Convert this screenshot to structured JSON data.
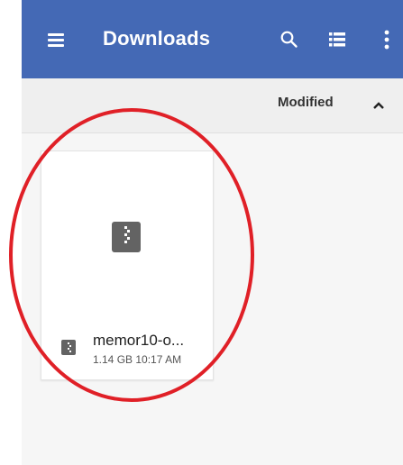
{
  "app_bar": {
    "title": "Downloads",
    "background_color": "#4469b5",
    "icons": [
      "menu-icon",
      "search-icon",
      "list-view-icon",
      "more-vert-icon"
    ]
  },
  "sort_bar": {
    "label": "Modified",
    "direction_icon": "chevron-up-icon"
  },
  "files": [
    {
      "name": "memor10-o...",
      "size": "1.14 GB",
      "time": "10:17 AM",
      "type_icon": "zip-file-icon"
    }
  ],
  "annotation": {
    "type": "red-circle-highlight",
    "color": "#e02027"
  }
}
